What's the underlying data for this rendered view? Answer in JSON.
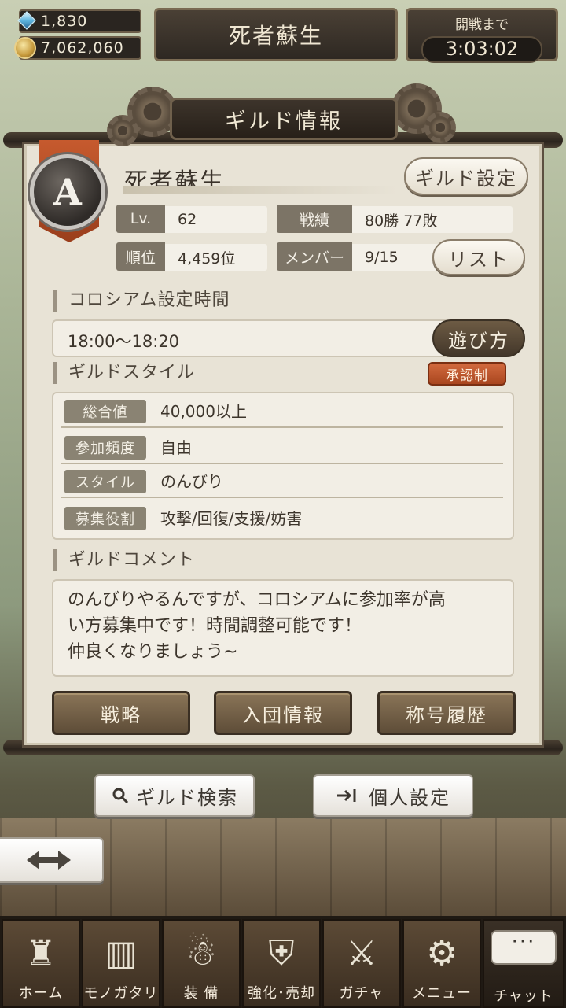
{
  "currency": {
    "gems": "1,830",
    "coins": "7,062,060"
  },
  "header": {
    "guild_name": "死者蘇生",
    "timer_label": "開戦まで",
    "timer_value": "3:03:02"
  },
  "panel": {
    "title": "ギルド情報",
    "rank_letter": "A",
    "guild_name": "死者蘇生",
    "guild_settings_button": "ギルド設定",
    "stats": {
      "level_label": "Lv.",
      "level_value": "62",
      "record_label": "戦績",
      "record_value": "80勝 77敗",
      "rank_label": "順位",
      "rank_value": "4,459位",
      "members_label": "メンバー",
      "members_value": "9/15",
      "list_button": "リスト"
    },
    "colosseum": {
      "title": "コロシアム設定時間",
      "time": "18:00〜18:20",
      "howto_button": "遊び方"
    },
    "style": {
      "title": "ギルドスタイル",
      "approval_badge": "承認制",
      "rows": [
        {
          "label": "総合値",
          "value": "40,000以上"
        },
        {
          "label": "参加頻度",
          "value": "自由"
        },
        {
          "label": "スタイル",
          "value": "のんびり"
        },
        {
          "label": "募集役割",
          "value": "攻撃/回復/支援/妨害"
        }
      ]
    },
    "comment": {
      "title": "ギルドコメント",
      "lines": [
        "のんびりやるんですが、コロシアムに参加率が高",
        "い方募集中です！時間調整可能です！",
        "仲良くなりましょう~"
      ]
    },
    "buttons": {
      "strategy": "戦略",
      "join_info": "入団情報",
      "title_history": "称号履歴"
    }
  },
  "actions": {
    "guild_search": "ギルド検索",
    "personal_settings": "個人設定"
  },
  "nav": {
    "home": "ホーム",
    "story": "モノガタリ",
    "equip": "装 備",
    "enhance": "強化･売却",
    "gacha": "ガチャ",
    "menu": "メニュー",
    "chat": "チャット"
  },
  "icons": [
    "gem-icon",
    "coin-icon",
    "search-icon",
    "enter-icon",
    "swap-arrows-icon",
    "castle-icon",
    "book-icon",
    "puppet-icon",
    "enhance-icon",
    "crossed-swords-icon",
    "gears-icon",
    "chat-bubble-icon"
  ]
}
